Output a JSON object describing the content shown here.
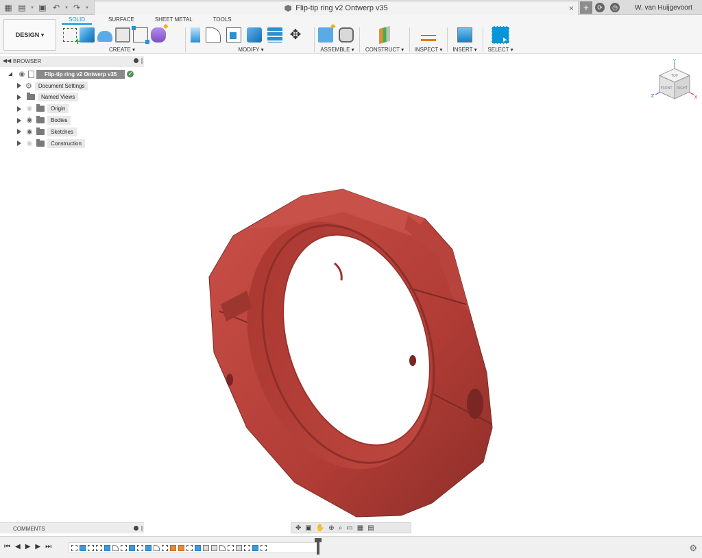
{
  "titlebar": {
    "document_title": "Flip-tip ring v2 Ontwerp v35",
    "close_glyph": "×",
    "new_tab_glyph": "+",
    "user_name": "W. van Huijgevoort"
  },
  "ribbon": {
    "workspace_button": "DESIGN ▾",
    "tabs": [
      "SOLID",
      "SURFACE",
      "SHEET METAL",
      "TOOLS"
    ],
    "active_tab": "SOLID",
    "groups": {
      "create": "CREATE ▾",
      "modify": "MODIFY ▾",
      "assemble": "ASSEMBLE ▾",
      "construct": "CONSTRUCT ▾",
      "inspect": "INSPECT ▾",
      "insert": "INSERT ▾",
      "select": "SELECT ▾"
    }
  },
  "browser": {
    "title": "BROWSER",
    "root": "Flip-tip ring v2 Ontwerp v35",
    "items": [
      {
        "label": "Document Settings",
        "icon": "gear-icon",
        "visible": null
      },
      {
        "label": "Named Views",
        "icon": "folder-icon",
        "visible": null
      },
      {
        "label": "Origin",
        "icon": "folder-icon",
        "visible": false
      },
      {
        "label": "Bodies",
        "icon": "folder-icon",
        "visible": true
      },
      {
        "label": "Sketches",
        "icon": "folder-icon",
        "visible": true
      },
      {
        "label": "Construction",
        "icon": "folder-icon",
        "visible": false
      }
    ]
  },
  "viewcube": {
    "faces": [
      "TOP",
      "FRONT",
      "RIGHT"
    ],
    "axes": [
      "Y",
      "Z",
      "X"
    ]
  },
  "comments": {
    "title": "COMMENTS"
  },
  "colors": {
    "accent": "#0696d7",
    "model_red": "#b8413a",
    "axis_x": "#e04040",
    "axis_y": "#3cb043",
    "axis_z": "#3a6be0"
  }
}
